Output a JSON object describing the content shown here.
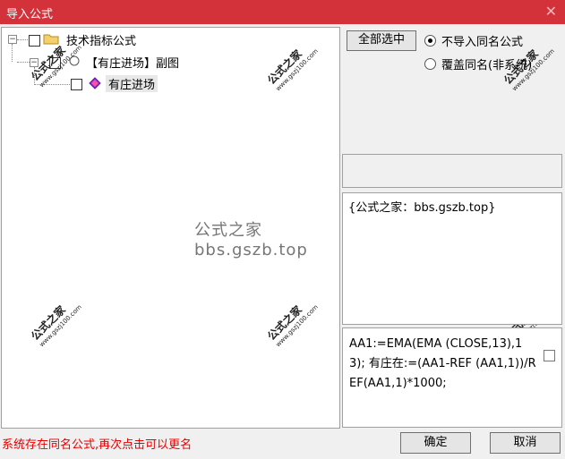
{
  "window": {
    "title": "导入公式",
    "close_icon": "close-icon"
  },
  "tree": {
    "root": {
      "label": "技术指标公式",
      "expander": "⊟"
    },
    "child": {
      "label": "【有庄进场】副图",
      "expander": "⊟"
    },
    "leaf": {
      "label": "有庄进场"
    }
  },
  "buttons": {
    "select_all": "全部选中",
    "ok": "确定",
    "cancel": "取消"
  },
  "options": {
    "no_import": "不导入同名公式",
    "overwrite": "覆盖同名(非系统)",
    "selected": "no_import"
  },
  "info_text": "{公式之家：bbs.gszb.top}",
  "code_text": "AA1:=EMA(EMA (CLOSE,13),13); 有庄在:=(AA1-REF (AA1,1))/REF(AA1,1)*1000;",
  "status_message": "系统存在同名公式,再次点击可以更名",
  "watermark": {
    "center": "公式之家 bbs.gszb.top",
    "stamp_cn": "公式之家",
    "stamp_url": "www.gszj100.com"
  }
}
